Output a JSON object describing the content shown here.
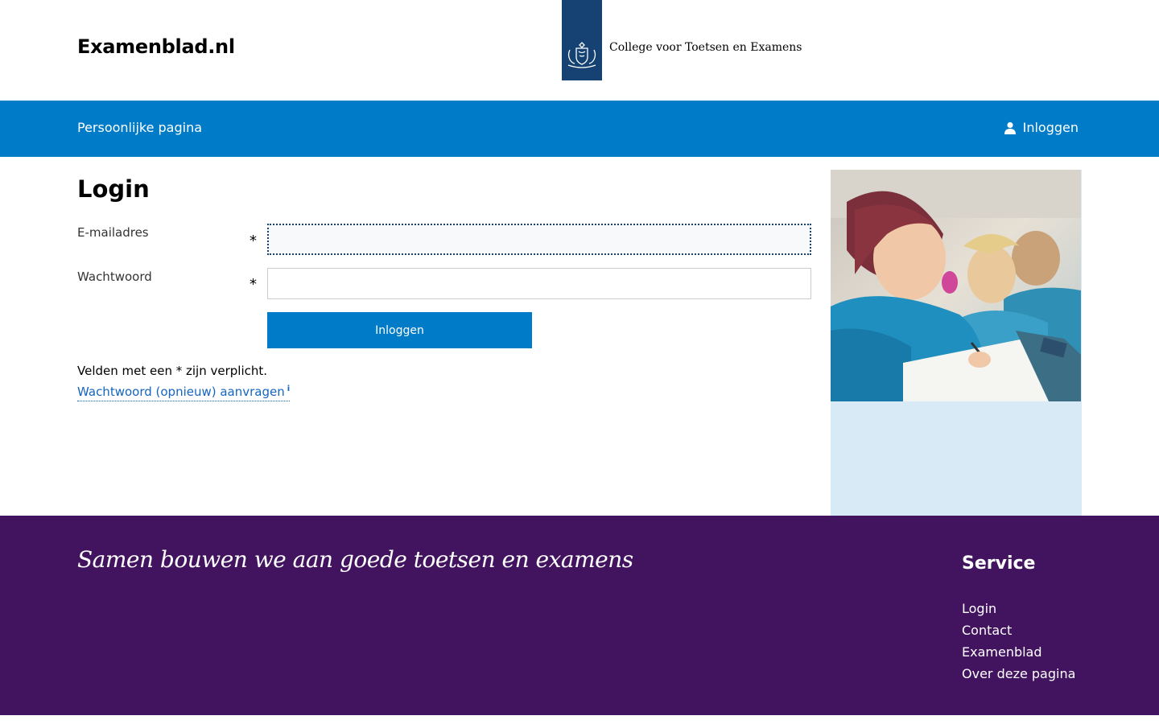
{
  "header": {
    "site_name": "Examenblad.nl",
    "org_name": "College voor Toetsen en Examens"
  },
  "nav": {
    "personal_page": "Persoonlijke pagina",
    "login": "Inloggen"
  },
  "main": {
    "title": "Login",
    "email_label": "E-mailadres",
    "password_label": "Wachtwoord",
    "required_marker": "*",
    "submit_label": "Inloggen",
    "required_note": "Velden met een * zijn verplicht.",
    "reset_link": "Wachtwoord (opnieuw) aanvragen",
    "info_marker": "i"
  },
  "footer": {
    "slogan": "Samen bouwen we aan goede toetsen en examens",
    "service_heading": "Service",
    "links": [
      "Login",
      "Contact",
      "Examenblad",
      "Over deze pagina"
    ]
  },
  "colors": {
    "nav_blue": "#007bc7",
    "logo_blue": "#154273",
    "footer_purple": "#42145f",
    "side_panel": "#d9eaf7"
  }
}
